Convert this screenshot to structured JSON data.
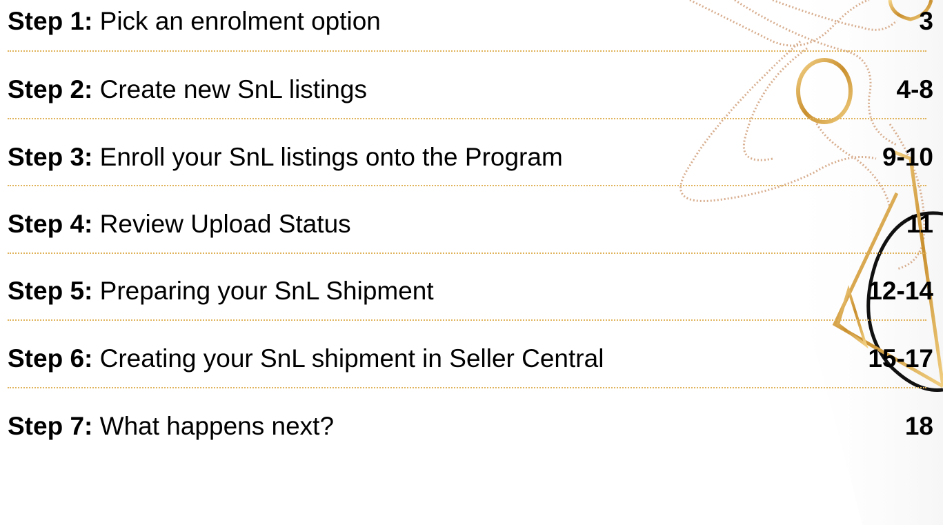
{
  "toc": {
    "items": [
      {
        "step": "Step 1:",
        "title": "Pick an enrolment option",
        "page": "3"
      },
      {
        "step": "Step 2:",
        "title": "Create new SnL listings",
        "page": "4-8"
      },
      {
        "step": "Step 3:",
        "title": "Enroll your SnL listings onto the Program",
        "page": "9-10"
      },
      {
        "step": "Step 4:",
        "title": "Review Upload Status",
        "page": "11"
      },
      {
        "step": "Step 5:",
        "title": "Preparing your SnL Shipment",
        "page": "12-14"
      },
      {
        "step": "Step 6:",
        "title": "Creating your SnL shipment in Seller Central",
        "page": "15-17"
      },
      {
        "step": "Step 7:",
        "title": "What happens next?",
        "page": "18"
      }
    ]
  },
  "colors": {
    "text": "#000000",
    "rule": "#e0b35a",
    "jewelry_gold": "#d9a441",
    "jewelry_rose": "#d8ae8f"
  }
}
